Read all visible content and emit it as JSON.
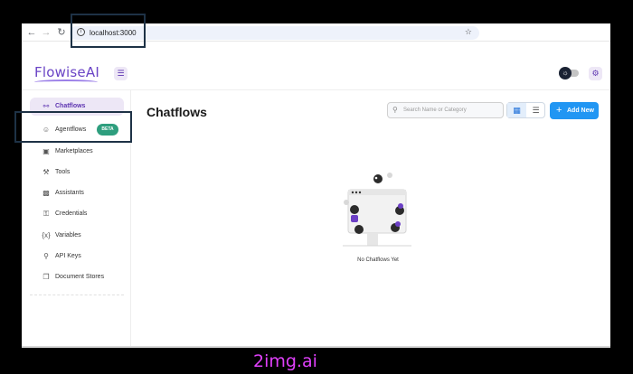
{
  "browser": {
    "url": "localhost:3000",
    "back_icon": "arrow-left-icon",
    "forward_icon": "arrow-right-icon",
    "reload_icon": "reload-icon",
    "info_icon": "info-icon",
    "bookmark_icon": "star-icon"
  },
  "header": {
    "logo_text": "FlowiseAI",
    "menu_icon": "hamburger-menu-icon",
    "theme_icon": "sun-icon",
    "settings_icon": "gear-icon"
  },
  "sidebar": {
    "items": [
      {
        "label": "Chatflows",
        "icon": "hierarchy-icon",
        "active": true
      },
      {
        "label": "Agentflows",
        "icon": "users-group-icon",
        "badge": "BETA"
      },
      {
        "label": "Marketplaces",
        "icon": "building-store-icon"
      },
      {
        "label": "Tools",
        "icon": "tool-icon"
      },
      {
        "label": "Assistants",
        "icon": "robot-icon"
      },
      {
        "label": "Credentials",
        "icon": "lock-icon"
      },
      {
        "label": "Variables",
        "icon": "variable-icon"
      },
      {
        "label": "API Keys",
        "icon": "key-icon"
      },
      {
        "label": "Document Stores",
        "icon": "files-icon"
      }
    ]
  },
  "main": {
    "title": "Chatflows",
    "search_placeholder": "Search Name or Category",
    "add_button_label": "Add New",
    "empty_message": "No Chatflows Yet"
  },
  "colors": {
    "accent": "#5e35b1",
    "primary_button": "#2196f3",
    "beta_badge": "#2e9e7e",
    "highlight_box": "#1e3246",
    "watermark": "#e040fb"
  },
  "watermark": "2img.ai"
}
